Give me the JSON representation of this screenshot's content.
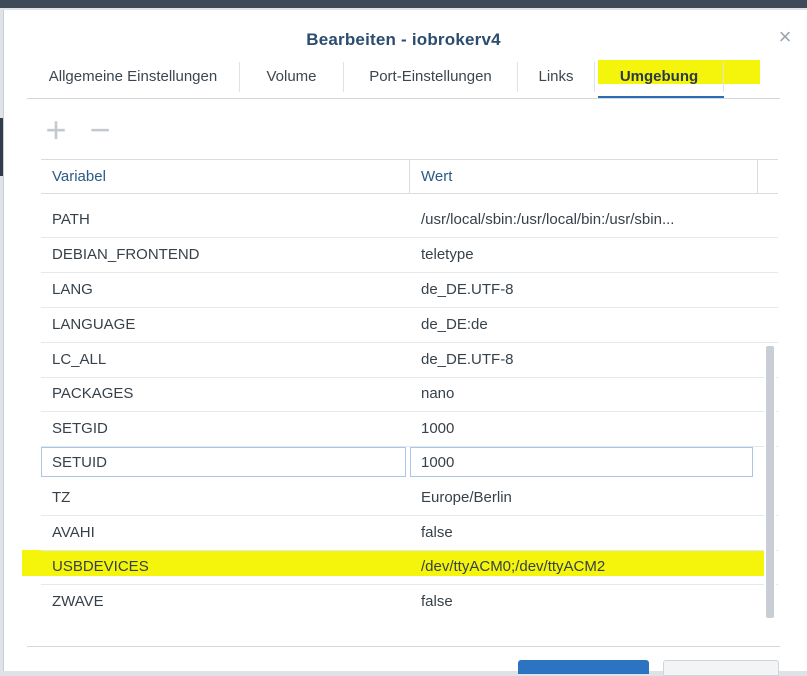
{
  "window": {
    "title": "Bearbeiten - iobrokerv4",
    "close_icon": "×"
  },
  "tabs": [
    {
      "label": "Allgemeine Einstellungen"
    },
    {
      "label": "Volume"
    },
    {
      "label": "Port-Einstellungen"
    },
    {
      "label": "Links"
    },
    {
      "label": "Umgebung",
      "active": true
    }
  ],
  "toolbar": {
    "add_icon": "+",
    "remove_icon": "−"
  },
  "table": {
    "headers": [
      "Variabel",
      "Wert"
    ],
    "rows": [
      {
        "variable": "PATH",
        "value": "/usr/local/sbin:/usr/local/bin:/usr/sbin..."
      },
      {
        "variable": "DEBIAN_FRONTEND",
        "value": "teletype"
      },
      {
        "variable": "LANG",
        "value": "de_DE.UTF-8"
      },
      {
        "variable": "LANGUAGE",
        "value": "de_DE:de"
      },
      {
        "variable": "LC_ALL",
        "value": "de_DE.UTF-8"
      },
      {
        "variable": "PACKAGES",
        "value": "nano"
      },
      {
        "variable": "SETGID",
        "value": "1000"
      },
      {
        "variable": "SETUID",
        "value": "1000"
      },
      {
        "variable": "TZ",
        "value": "Europe/Berlin"
      },
      {
        "variable": "AVAHI",
        "value": "false"
      },
      {
        "variable": "USBDEVICES",
        "value": "/dev/ttyACM0;/dev/ttyACM2"
      },
      {
        "variable": "ZWAVE",
        "value": "false"
      }
    ]
  },
  "colors": {
    "title": "#2a4c6e",
    "highlight": "#f4f50a",
    "primary_button": "#2c73c2"
  }
}
